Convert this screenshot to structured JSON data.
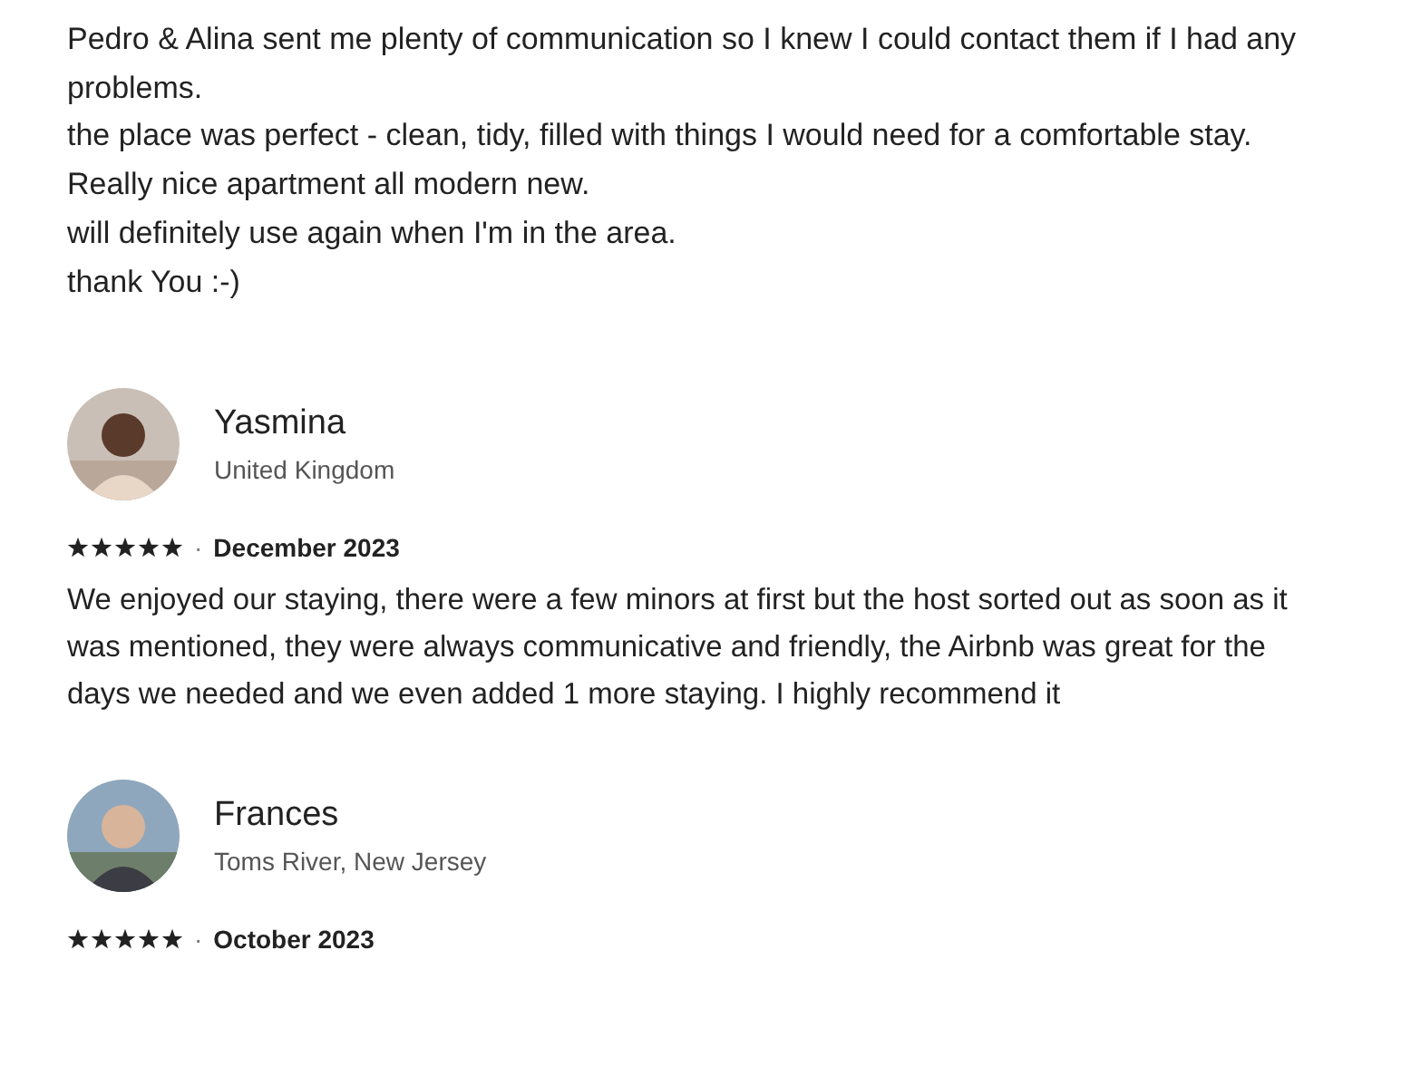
{
  "top_review": {
    "lines": [
      "Pedro & Alina sent me plenty of communication so I knew I could contact them if I had any problems.",
      "the place was perfect - clean, tidy, filled with things I would need for a comfortable stay.",
      "Really nice apartment all modern new.",
      "will definitely use again when I'm in the area.",
      "thank You :-)"
    ]
  },
  "reviews": [
    {
      "name": "Yasmina",
      "location": "United Kingdom",
      "stars": 5,
      "separator": "·",
      "date": "December 2023",
      "text": "We enjoyed our staying, there were a few minors at first but the host sorted out as soon as it was mentioned, they were always communicative and friendly, the Airbnb was great for the days we needed and we even added 1 more staying. I highly recommend it"
    },
    {
      "name": "Frances",
      "location": "Toms River, New Jersey",
      "stars": 5,
      "separator": "·",
      "date": "October 2023"
    }
  ]
}
